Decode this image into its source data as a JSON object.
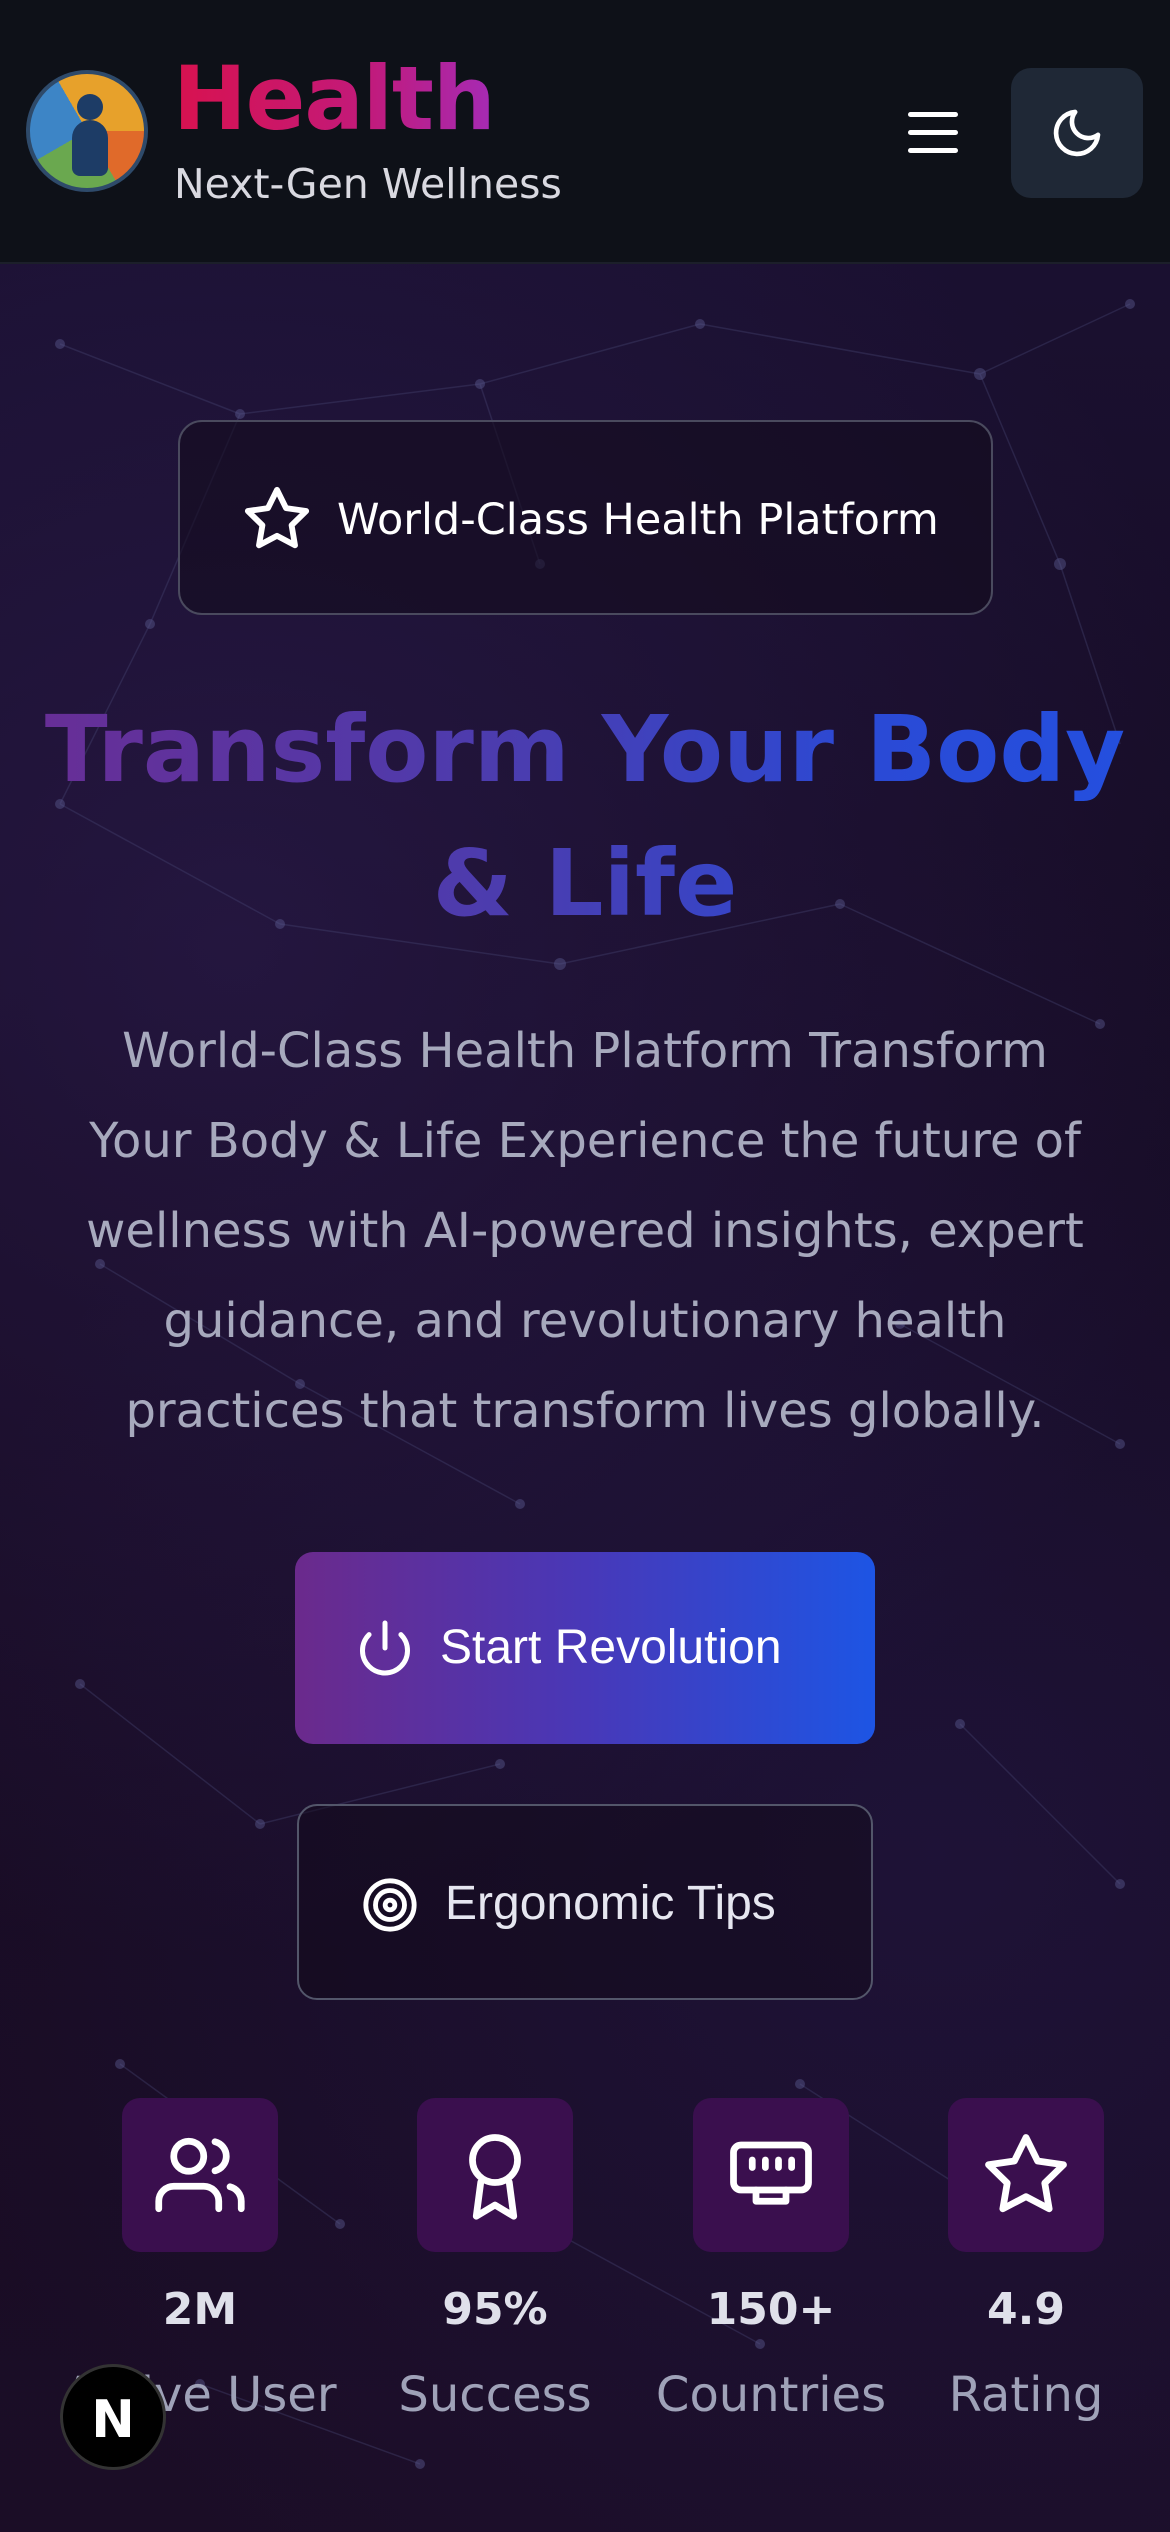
{
  "header": {
    "brand_title": "Health",
    "brand_subtitle": "Next-Gen Wellness",
    "menu_icon": "hamburger-menu-icon",
    "theme_icon": "moon-icon"
  },
  "badge": {
    "icon": "star-icon",
    "text": "World-Class Health Platform"
  },
  "hero": {
    "headline": "Transform Your Body & Life",
    "description": "World-Class Health Platform Transform Your Body & Life Experience the future of wellness with AI-powered insights, expert guidance, and revolutionary health practices that transform lives globally."
  },
  "actions": {
    "primary_label": "Start Revolution",
    "primary_icon": "power-icon",
    "secondary_label": "Ergonomic Tips",
    "secondary_icon": "target-icon"
  },
  "stats": [
    {
      "icon": "users-icon",
      "value": "2M",
      "label": "Active User"
    },
    {
      "icon": "award-icon",
      "value": "95%",
      "label": "Success"
    },
    {
      "icon": "network-icon",
      "value": "150+",
      "label": "Countries"
    },
    {
      "icon": "star-icon",
      "value": "4.9",
      "label": "Rating"
    }
  ],
  "dev_badge": {
    "text": "N"
  },
  "colors": {
    "brand_gradient_start": "#d8124f",
    "brand_gradient_end": "#a52bb5",
    "headline_gradient_start": "#6a2d94",
    "headline_gradient_end": "#2350e0",
    "stat_box": "#3a0f4e",
    "header_bg": "#0e1118",
    "page_bg": "#170c22"
  }
}
